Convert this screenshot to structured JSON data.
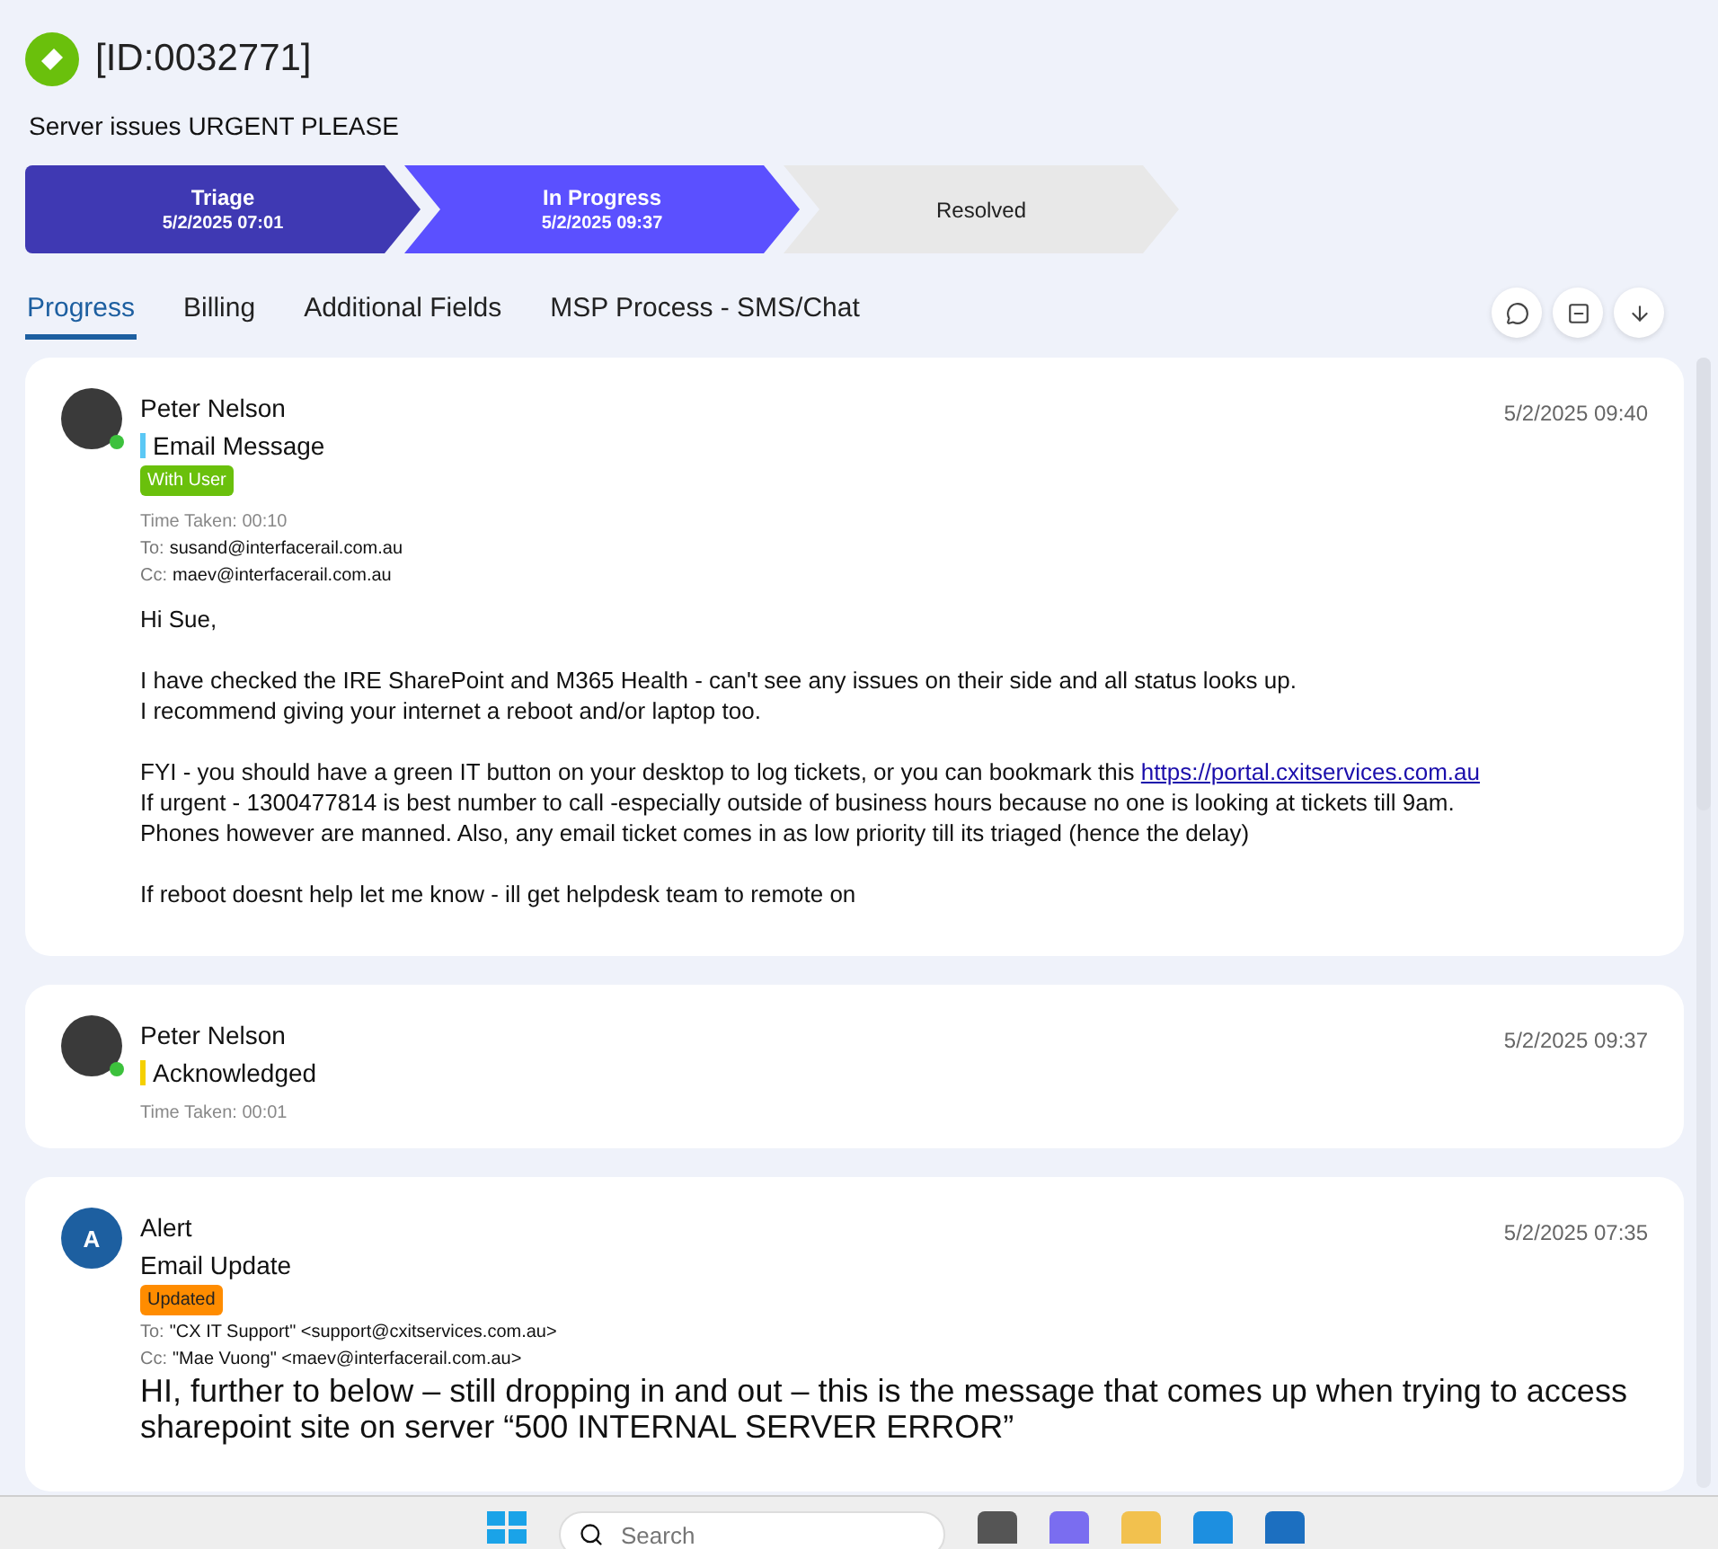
{
  "ticket": {
    "title": "[ID:0032771]",
    "subject": "Server issues URGENT PLEASE"
  },
  "stages": [
    {
      "label": "Triage",
      "date": "5/2/2025 07:01",
      "kind": "done"
    },
    {
      "label": "In Progress",
      "date": "5/2/2025 09:37",
      "kind": "current"
    },
    {
      "label": "Resolved",
      "kind": "pending"
    }
  ],
  "tabs": [
    {
      "label": "Progress",
      "selected": true
    },
    {
      "label": "Billing",
      "selected": false
    },
    {
      "label": "Additional Fields",
      "selected": false
    },
    {
      "label": "MSP Process - SMS/Chat",
      "selected": false
    }
  ],
  "entries": [
    {
      "kind": "email",
      "author": "Peter Nelson",
      "avatar": {
        "kind": "photo"
      },
      "online": true,
      "type": {
        "label": "Email Message",
        "color": "#5bc8f5"
      },
      "badge": {
        "text": "With User",
        "color": "#6ac00c"
      },
      "time_taken": "Time Taken: 00:10",
      "recipients": [
        {
          "label": "To:",
          "value": "susand@interfacerail.com.au"
        },
        {
          "label": "Cc:",
          "value": "maev@interfacerail.com.au"
        }
      ],
      "timestamp": "5/2/2025 09:40",
      "body": [
        [
          {
            "text": "Hi Sue,"
          }
        ],
        [
          {
            "text": "I have checked the IRE SharePoint and M365 Health - can't see any issues on their side and all status looks up."
          },
          {
            "text": "I recommend giving your internet a reboot and/or laptop too."
          }
        ],
        [
          {
            "text": "FYI - you should have a green IT button on your desktop to log tickets, or you can bookmark this ",
            "link": "https://portal.cxitservices.com.au"
          },
          {
            "text": "If urgent - 1300477814 is best number to call -especially outside of business hours because no one is looking at tickets till 9am."
          },
          {
            "text": "Phones however are manned. Also, any email ticket comes in as low priority till its triaged (hence the delay)"
          }
        ],
        [
          {
            "text": "If reboot doesnt help let me know - ill get helpdesk team to remote on"
          }
        ]
      ]
    },
    {
      "kind": "status",
      "author": "Peter Nelson",
      "avatar": {
        "kind": "photo"
      },
      "online": true,
      "type": {
        "label": "Acknowledged",
        "color": "#f5d000"
      },
      "time_taken": "Time Taken: 00:01",
      "timestamp": "5/2/2025 09:37"
    },
    {
      "kind": "email-update",
      "author": "Alert",
      "avatar": {
        "kind": "initial",
        "initial": "A"
      },
      "type": {
        "label": "Email Update"
      },
      "badge": {
        "text": "Updated",
        "color": "#ff8c00"
      },
      "recipients": [
        {
          "label": "To:",
          "value": "\"CX IT Support\" <support@cxitservices.com.au>"
        },
        {
          "label": "Cc:",
          "value": "\"Mae Vuong\" <maev@interfacerail.com.au>"
        }
      ],
      "timestamp": "5/2/2025 07:35",
      "body": [
        [
          {
            "text": "HI, further to below – still dropping in and out – this is the message that comes up when trying to access sharepoint site on server “500 INTERNAL SERVER ERROR”"
          }
        ]
      ]
    }
  ],
  "taskbar": {
    "search": {
      "placeholder": "Search"
    }
  }
}
